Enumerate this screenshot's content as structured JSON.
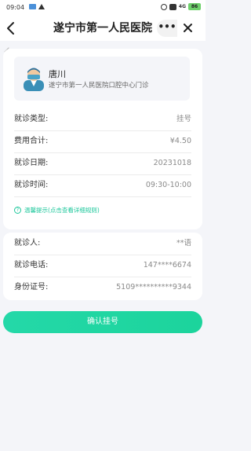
{
  "status_bar": {
    "time": "09:04",
    "signal_text": "4G",
    "battery": "86"
  },
  "nav": {
    "title": "遂宁市第一人民医院",
    "more_label": "•••"
  },
  "doctor": {
    "name": "唐川",
    "department": "遂宁市第一人民医院口腔中心门诊"
  },
  "details": [
    {
      "label": "就诊类型:",
      "value": "挂号"
    },
    {
      "label": "费用合计:",
      "value": "¥4.50"
    },
    {
      "label": "就诊日期:",
      "value": "20231018"
    },
    {
      "label": "就诊时间:",
      "value": "09:30-10:00"
    }
  ],
  "tip": {
    "icon_text": "?",
    "text": "温馨提示(点击查看详细规则)"
  },
  "patient": [
    {
      "label": "就诊人:",
      "value": "**语"
    },
    {
      "label": "就诊电话:",
      "value": "147****6674"
    },
    {
      "label": "身份证号:",
      "value": "5109**********9344"
    }
  ],
  "confirm_button": "确认挂号",
  "colors": {
    "accent": "#1cd49c",
    "background": "#f4f5f9"
  }
}
